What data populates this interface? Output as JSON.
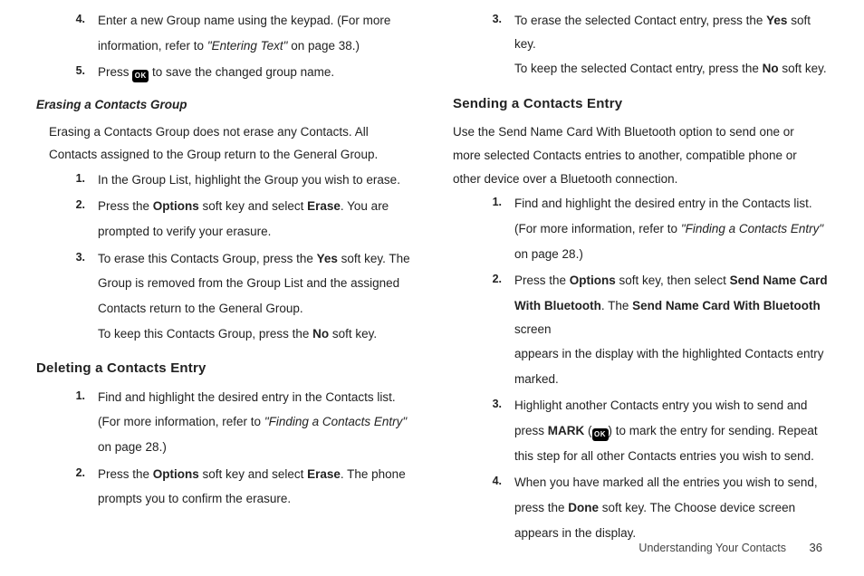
{
  "left": {
    "step4": {
      "num": "4.",
      "l1_a": "Enter a new Group name using the keypad. (For more",
      "l1_b": "information, refer to ",
      "ref": "\"Entering Text\"",
      "l1_c": "  on page 38.)"
    },
    "step5": {
      "num": "5.",
      "a": "Press ",
      "ok": "OK",
      "b": " to save the changed group name."
    },
    "sub_erase": "Erasing a Contacts Group",
    "erase_intro_a": "Erasing a Contacts Group does not erase any Contacts. All",
    "erase_intro_b": "Contacts assigned to the Group return to the General Group.",
    "e1": {
      "num": "1.",
      "t": "In the Group List, highlight the Group you wish to erase."
    },
    "e2": {
      "num": "2.",
      "a": "Press the ",
      "b1": "Options",
      "b": " soft key and select ",
      "b2": "Erase",
      "c": ". You are",
      "d": "prompted to verify your erasure."
    },
    "e3": {
      "num": "3.",
      "a": "To erase this Contacts Group, press the ",
      "b1": "Yes",
      "b": " soft key. The",
      "c": "Group is removed from the Group List and the assigned",
      "d": "Contacts return to the General Group.",
      "e": "To keep this Contacts Group, press the ",
      "b2": "No",
      "f": " soft key."
    },
    "head_delete": "Deleting a Contacts Entry",
    "d1": {
      "num": "1.",
      "a": "Find and highlight the desired entry in the Contacts list.",
      "b": "(For more information, refer to ",
      "ref": "\"Finding a Contacts Entry\"",
      "c": "on page 28.)"
    },
    "d2": {
      "num": "2.",
      "a": "Press the ",
      "b1": "Options",
      "b": " soft key and select ",
      "b2": "Erase",
      "c": ". The phone",
      "d": "prompts you to confirm the erasure."
    }
  },
  "right": {
    "r3": {
      "num": "3.",
      "a": "To erase the selected Contact entry, press the ",
      "b1": "Yes",
      "b": " soft key.",
      "c": "To keep the selected Contact entry, press the ",
      "b2": "No",
      "d": " soft key."
    },
    "head_send": "Sending a Contacts Entry",
    "send_intro_a": "Use the Send Name Card With Bluetooth option to send one or",
    "send_intro_b": "more selected Contacts entries to another, compatible phone or",
    "send_intro_c": "other device over a Bluetooth connection.",
    "s1": {
      "num": "1.",
      "a": "Find and highlight the desired entry in the Contacts list.",
      "b": "(For more information, refer to ",
      "ref": "\"Finding a Contacts Entry\"",
      "c": "on page 28.)"
    },
    "s2": {
      "num": "2.",
      "a": "Press the ",
      "b1": "Options",
      "b": " soft key, then select ",
      "b2": "Send Name Card",
      "c": "With Bluetooth",
      "d": ". The ",
      "b3": "Send Name Card With Bluetooth",
      "e": " screen",
      "f": "appears in the display with the highlighted Contacts entry",
      "g": "marked."
    },
    "s3": {
      "num": "3.",
      "a": "Highlight another Contacts entry you wish to send and",
      "b": "press ",
      "b1": "MARK",
      "c": " (",
      "ok": "OK",
      "d": ") to mark the entry for sending. Repeat",
      "e": "this step for all other Contacts entries you wish to send."
    },
    "s4": {
      "num": "4.",
      "a": "When you have marked all the entries you wish to send,",
      "b": "press the ",
      "b1": "Done",
      "c": " soft key. The Choose device screen",
      "d": "appears in the display."
    }
  },
  "footer": {
    "section": "Understanding Your Contacts",
    "page": "36"
  }
}
